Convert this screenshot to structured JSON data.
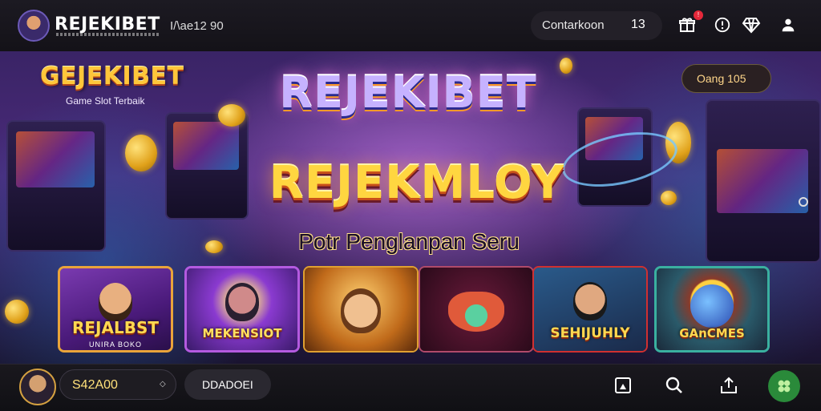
{
  "header": {
    "brand": "REJEKIBET",
    "user_id": "I/\\ae12 90",
    "counter_label": "Contarkoon",
    "counter_value": "13",
    "notification_badge": "!"
  },
  "banner": {
    "mini_logo": "GEJEKIBET",
    "mini_subtitle": "Game Slot Terbaik",
    "bonus_label": "Oang 105",
    "main_logo": "REJEKIBET",
    "slogan": "REJEKMLOY",
    "tagline": "Potr Penglanpan Seru"
  },
  "games": [
    {
      "title": "REJALBST",
      "subtitle": "UNIRA BOKO",
      "accent": "#e9a43a"
    },
    {
      "title": "MEKENSIOT",
      "subtitle": "",
      "accent": "#b45ae0"
    },
    {
      "title": "",
      "subtitle": "",
      "accent": "#e0a030"
    },
    {
      "title": "",
      "subtitle": "",
      "accent": "#b04a6a"
    },
    {
      "title": "SEHIJUHLY",
      "subtitle": "",
      "accent": "#d03030"
    },
    {
      "title": "GAnCMES",
      "subtitle": "",
      "accent": "#3ab0a0"
    }
  ],
  "footer": {
    "balance": "S42A00",
    "deposit_label": "DDADOEI"
  },
  "icons": {
    "top": [
      "gift-icon",
      "info-icon",
      "diamond-icon",
      "user-icon"
    ],
    "bottom": [
      "bookmark-icon",
      "search-icon",
      "upload-icon",
      "clover-icon"
    ]
  },
  "colors": {
    "accent_gold": "#ffd640",
    "banner_purple": "#4a2a7a",
    "action_green": "#2a8a3a"
  }
}
